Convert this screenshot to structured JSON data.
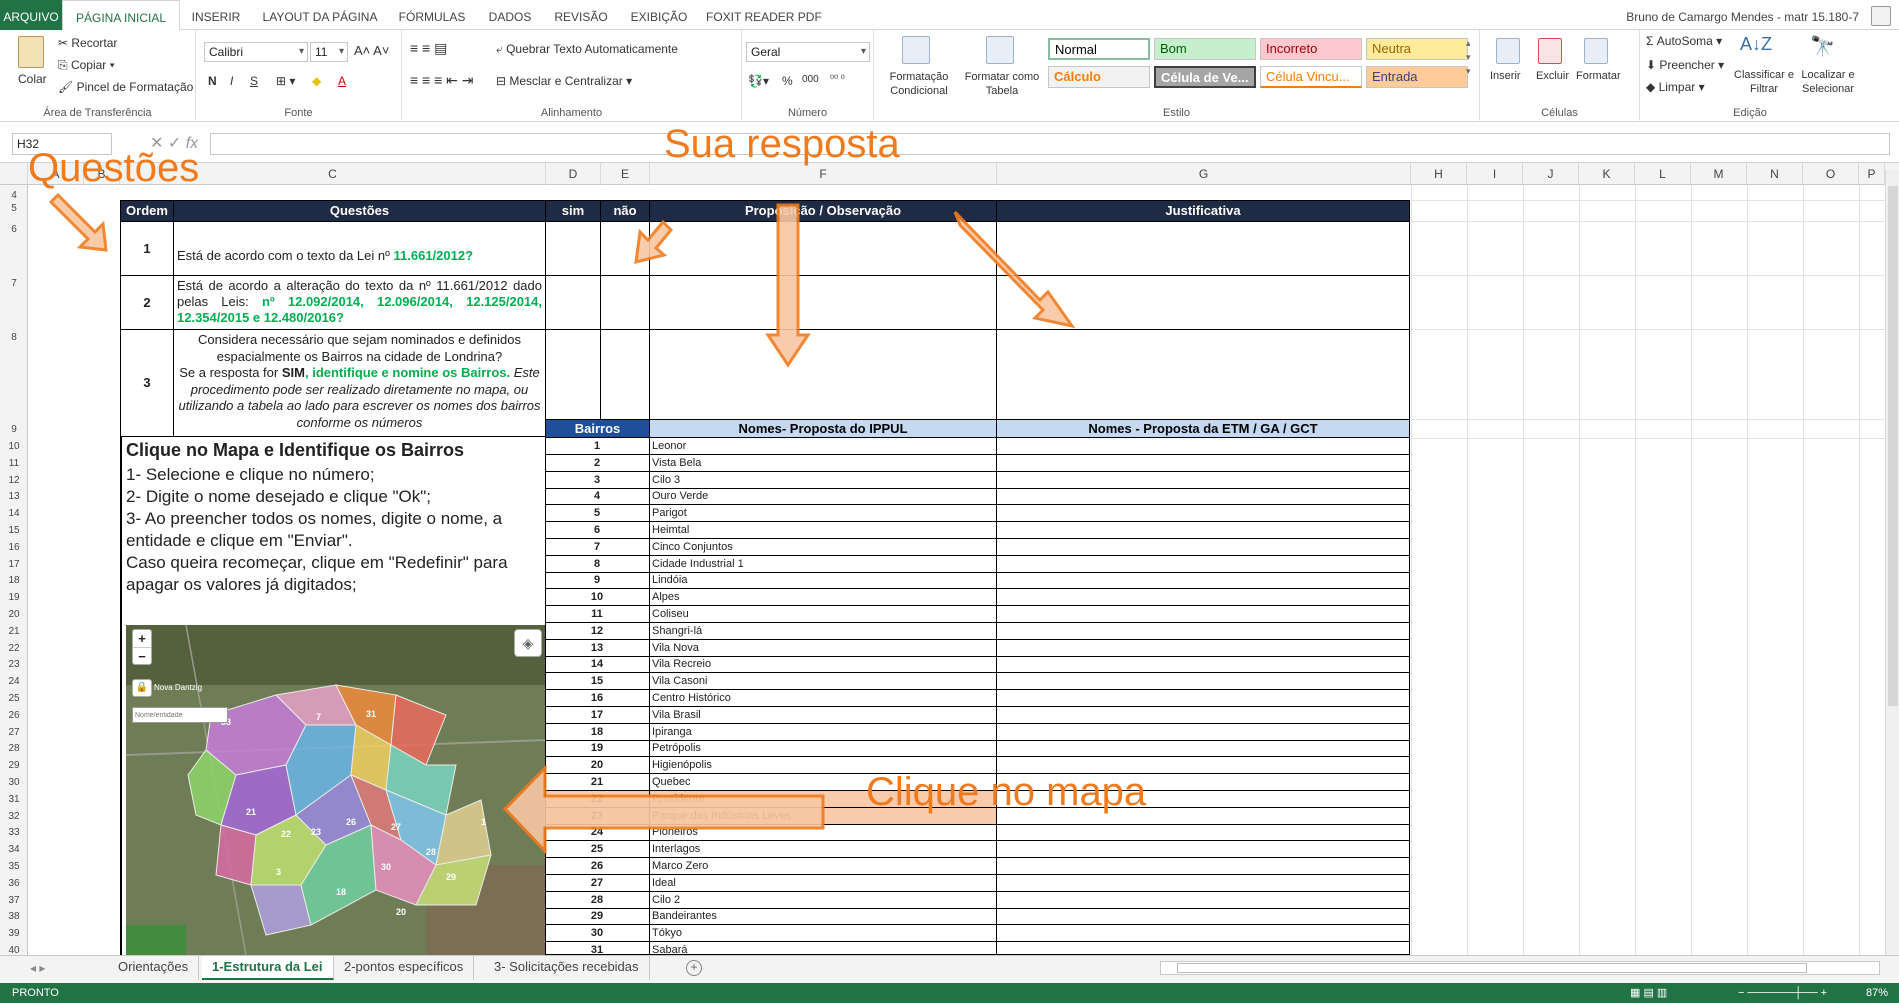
{
  "ribbon_tabs": [
    "ARQUIVO",
    "PÁGINA INICIAL",
    "INSERIR",
    "LAYOUT DA PÁGINA",
    "FÓRMULAS",
    "DADOS",
    "REVISÃO",
    "EXIBIÇÃO",
    "FOXIT READER PDF"
  ],
  "user": "Bruno de Camargo Mendes - matr 15.180-7",
  "clipboard": {
    "paste": "Colar",
    "cut": "Recortar",
    "copy": "Copiar",
    "format_painter": "Pincel de Formatação",
    "group": "Área de Transferência"
  },
  "font": {
    "name": "Calibri",
    "size": "11",
    "group": "Fonte"
  },
  "alignment": {
    "wrap": "Quebrar Texto Automaticamente",
    "merge": "Mesclar e Centralizar",
    "group": "Alinhamento"
  },
  "number": {
    "format": "Geral",
    "percent": "%",
    "thousands": "000",
    "group": "Número"
  },
  "styles": {
    "cond_format": "Formatação Condicional",
    "format_table": "Formatar como Tabela",
    "cells": [
      {
        "label": "Normal",
        "bg": "#ffffff",
        "fg": "#000000"
      },
      {
        "label": "Bom",
        "bg": "#c6efce",
        "fg": "#006100"
      },
      {
        "label": "Incorreto",
        "bg": "#ffc7ce",
        "fg": "#9c0006"
      },
      {
        "label": "Neutra",
        "bg": "#ffeb9c",
        "fg": "#9c6500"
      },
      {
        "label": "Cálculo",
        "bg": "#f2f2f2",
        "fg": "#fa7d00"
      },
      {
        "label": "Célula de Ve...",
        "bg": "#a5a5a5",
        "fg": "#ffffff"
      },
      {
        "label": "Célula Vincu...",
        "bg": "#ffffff",
        "fg": "#fa7d00"
      },
      {
        "label": "Entrada",
        "bg": "#ffcc99",
        "fg": "#3f3f76"
      }
    ],
    "group": "Estilo"
  },
  "cells_group": {
    "insert": "Inserir",
    "delete": "Excluir",
    "format": "Formatar",
    "group": "Células"
  },
  "editing": {
    "autosum": "AutoSoma",
    "fill": "Preencher",
    "clear": "Limpar",
    "sort": "Classificar e Filtrar",
    "find": "Localizar e Selecionar",
    "group": "Edição"
  },
  "namebox": "H32",
  "columns": [
    "A",
    "B",
    "C",
    "D",
    "E",
    "F",
    "G",
    "H",
    "I",
    "J",
    "K",
    "L",
    "M",
    "N",
    "O",
    "P"
  ],
  "rows": [
    "4",
    "5",
    "6",
    "7",
    "8",
    "9",
    "10",
    "11",
    "12",
    "13",
    "14",
    "15",
    "16",
    "17",
    "18",
    "19",
    "20",
    "21",
    "22",
    "23",
    "24",
    "25",
    "26",
    "27",
    "28",
    "29",
    "30",
    "31",
    "32",
    "33",
    "34",
    "35",
    "36",
    "37",
    "38",
    "39",
    "40"
  ],
  "table": {
    "h_ordem": "Ordem",
    "h_questoes": "Questões",
    "h_sim": "sim",
    "h_nao": "não",
    "h_prop": "Proposição / Observação",
    "h_just": "Justificativa",
    "q1_num": "1",
    "q1_text": "Está de acordo com o texto da Lei nº ",
    "q1_law": "11.661/2012?",
    "q2_num": "2",
    "q2_text": "Está de acordo a alteração do texto da nº 11.661/2012 dado pelas Leis: ",
    "q2_laws": "nº 12.092/2014, 12.096/2014, 12.125/2014, 12.354/2015 e 12.480/2016?",
    "q3_num": "3",
    "q3_a": "Considera necessário que sejam nominados e definidos espacialmente os Bairros na cidade de Londrina?",
    "q3_b1": "Se a resposta for ",
    "q3_sim": "SIM",
    "q3_b2": ", identifique e nomine os Bairros.",
    "q3_c": " Este procedimento pode ser realizado diretamente no mapa, ou utilizando a tabela ao lado para escrever os nomes dos bairros conforme os números",
    "h_bairros": "Bairros",
    "h_ippul": "Nomes- Proposta do IPPUL",
    "h_etm": "Nomes - Proposta da ETM / GA / GCT"
  },
  "instructions": {
    "title": "Clique no Mapa e Identifique os Bairros",
    "l1": "1- Selecione e clique no número;",
    "l2": "2- Digite o nome desejado e clique \"Ok\";",
    "l3": "3- Ao preencher todos os nomes, digite o nome, a entidade e clique em \"Enviar\".",
    "l4": "Caso queira recomeçar, clique em \"Redefinir\" para apagar os valores já digitados;"
  },
  "map": {
    "zoom_in": "+",
    "zoom_out": "−",
    "place": "Nova Dantzig",
    "input_placeholder": "Nome/entidade",
    "labels": [
      "58",
      "7",
      "31",
      "21",
      "22",
      "23",
      "26",
      "27",
      "28",
      "29",
      "30",
      "1",
      "3",
      "18",
      "20"
    ]
  },
  "bairros": [
    [
      "1",
      "Leonor"
    ],
    [
      "2",
      "Vista Bela"
    ],
    [
      "3",
      "Cilo 3"
    ],
    [
      "4",
      "Ouro Verde"
    ],
    [
      "5",
      "Parigot"
    ],
    [
      "6",
      "Heimtal"
    ],
    [
      "7",
      "Cinco Conjuntos"
    ],
    [
      "8",
      "Cidade Industrial 1"
    ],
    [
      "9",
      "Lindóia"
    ],
    [
      "10",
      "Alpes"
    ],
    [
      "11",
      "Coliseu"
    ],
    [
      "12",
      "Shangri-lá"
    ],
    [
      "13",
      "Vila Nova"
    ],
    [
      "14",
      "Vila Recreio"
    ],
    [
      "15",
      "Vila Casoni"
    ],
    [
      "16",
      "Centro Histórico"
    ],
    [
      "17",
      "Vila Brasil"
    ],
    [
      "18",
      "Ipiranga"
    ],
    [
      "19",
      "Petrópolis"
    ],
    [
      "20",
      "Higienópolis"
    ],
    [
      "21",
      "Quebec"
    ],
    [
      "22",
      "Presidente"
    ],
    [
      "23",
      "Parque das Indústrias Leves"
    ],
    [
      "24",
      "Pioneiros"
    ],
    [
      "25",
      "Interlagos"
    ],
    [
      "26",
      "Marco Zero"
    ],
    [
      "27",
      "Ideal"
    ],
    [
      "28",
      "Cilo 2"
    ],
    [
      "29",
      "Bandeirantes"
    ],
    [
      "30",
      "Tókyo"
    ],
    [
      "31",
      "Sabará"
    ]
  ],
  "overlays": {
    "questoes": "Questões",
    "sua_resposta": "Sua resposta",
    "clique_mapa": "Clique no mapa"
  },
  "sheet_tabs": [
    "Orientações",
    "1-Estrutura da Lei",
    "2-pontos específicos",
    "3- Solicitações recebidas"
  ],
  "status": "PRONTO",
  "zoom": "87%",
  "colors": {
    "excel_green": "#217346",
    "header_navy": "#1f2a44",
    "header_blue": "#c5d9f1",
    "accent_orange": "#f07b1e",
    "highlight_row": "#f8cbad"
  }
}
